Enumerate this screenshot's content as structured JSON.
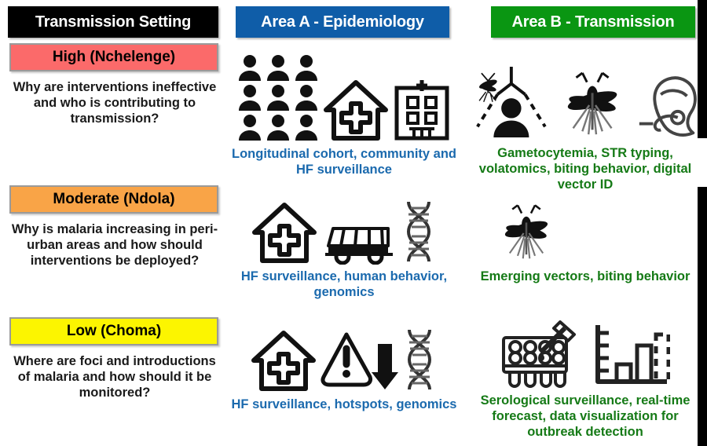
{
  "headers": {
    "setting": "Transmission Setting",
    "area_a": "Area A - Epidemiology",
    "area_b": "Area B - Transmission"
  },
  "colors": {
    "black": "#000000",
    "blue": "#0F5DA8",
    "green": "#0A9612",
    "high_red": "#FB6A6A",
    "moderate_orange": "#F9A447",
    "low_yellow": "#FCF500",
    "caption_blue": "#1B6AAE",
    "caption_green": "#157A16"
  },
  "rows": [
    {
      "level": "High (Nchelenge)",
      "question": "Why are interventions ineffective and who is contributing to transmission?",
      "area_a_caption": "Longitudinal cohort, community and HF surveillance",
      "area_b_caption": "Gametocytemia, STR typing, volatomics, biting behavior, digital vector ID",
      "area_a_icons": [
        "people-group-icon",
        "health-house-icon",
        "hospital-building-icon"
      ],
      "area_b_icons": [
        "mosquito-bednet-person-icon",
        "mosquito-icon",
        "mosquito-proboscis-icon"
      ]
    },
    {
      "level": "Moderate (Ndola)",
      "question": "Why is malaria increasing in peri-urban areas and how should interventions be deployed?",
      "area_a_caption": "HF surveillance, human behavior, genomics",
      "area_b_caption": "Emerging vectors, biting behavior",
      "area_a_icons": [
        "health-house-icon",
        "bus-icon",
        "dna-helix-icon"
      ],
      "area_b_icons": [
        "mosquito-icon"
      ]
    },
    {
      "level": "Low (Choma)",
      "question": "Where are foci and introductions of malaria and how should it be monitored?",
      "area_a_caption": "HF surveillance, hotspots, genomics",
      "area_b_caption": "Serological surveillance, real-time forecast, data visualization for outbreak detection",
      "area_a_icons": [
        "health-house-icon",
        "warning-triangle-down-arrow-icon",
        "dna-helix-icon"
      ],
      "area_b_icons": [
        "elisa-plate-pipette-icon",
        "bar-chart-forecast-icon"
      ]
    }
  ]
}
